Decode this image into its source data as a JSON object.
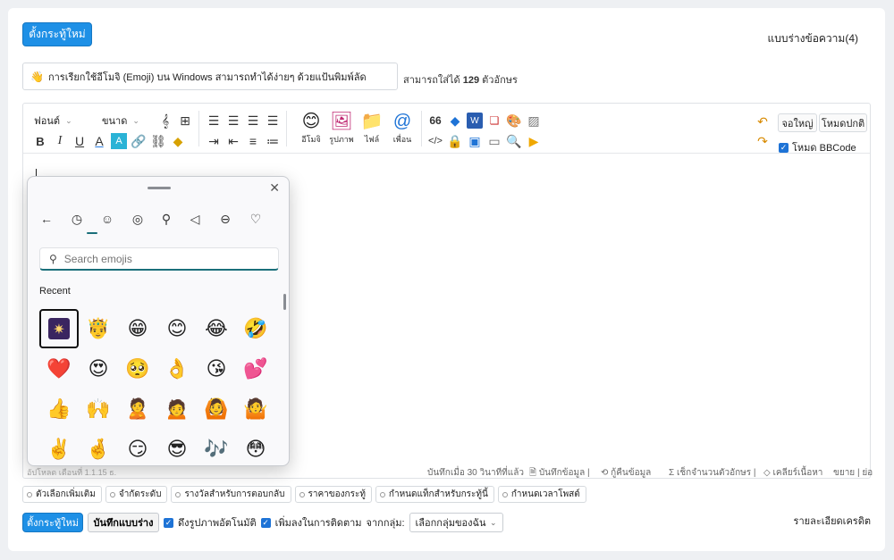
{
  "header": {
    "new_topic_label": "ตั้งกระทู้ใหม่",
    "drafts_label": "แบบร่างข้อความ(4)"
  },
  "title_field": {
    "value": "การเรียกใช้อีโมจิ (Emoji) บน Windows สามารถทำได้ง่ายๆ ด้วยแป้นพิมพ์ลัด",
    "limit_prefix": "สามารถใส่ได้",
    "limit_count": "129",
    "limit_suffix": "ตัวอักษร"
  },
  "toolbar": {
    "font_label": "ฟอนต์",
    "size_label": "ขนาด",
    "emoji_label": "อีโมจิ",
    "image_label": "รูปภาพ",
    "file_label": "ไฟล์",
    "friend_label": "เพื่อน",
    "fullscreen_label": "จอใหญ่",
    "normal_mode_label": "โหมดปกติ",
    "bbcode_label": "โหมด BBCode"
  },
  "status_bar": {
    "cut_text": "อัปโหลด เดือนที่ 1.1.15 ธ.",
    "saved_ago": "บันทึกเมื่อ 30 วินาทีที่แล้ว",
    "save_data": "บันทึกข้อมูล |",
    "restore_data": "กู้คืนข้อมูล",
    "count_chars": "เช็กจำนวนตัวอักษร |",
    "clear_content": "เคลียร์เนื้อหา",
    "expand_collapse": "ขยาย | ย่อ"
  },
  "emoji_panel": {
    "search_placeholder": "Search emojis",
    "recent_label": "Recent",
    "categories": [
      "back-arrow",
      "clock",
      "smiley",
      "face-sticker",
      "kaomoji",
      "pizza",
      "car",
      "heart"
    ],
    "emojis": [
      "🎆",
      "🤴",
      "😁",
      "😊",
      "😂",
      "🤣",
      "❤️",
      "😍",
      "🥺",
      "👌",
      "😘",
      "💕",
      "👍",
      "🙌",
      "🙎",
      "🙍",
      "🙆",
      "🤷",
      "✌️",
      "🤞",
      "😏",
      "😎",
      "🎶",
      "😳"
    ]
  },
  "options": {
    "chips": [
      "ตัวเลือกเพิ่มเติม",
      "จำกัดระดับ",
      "รางวัลสำหรับการตอบกลับ",
      "ราคาของกระทู้",
      "กำหนดแท็กสำหรับกระทู้นี้",
      "กำหนดเวลาโพสต์"
    ]
  },
  "footer": {
    "new_topic_label": "ตั้งกระทู้ใหม่",
    "save_draft_label": "บันทึกแบบร่าง",
    "auto_image_label": "ดึงรูปภาพอัตโนมัติ",
    "follow_label": "เพิ่มลงในการติดตาม",
    "from_group_label": "จากกลุ่ม:",
    "group_select_value": "เลือกกลุ่มของฉัน",
    "credits_label": "รายละเอียดเครดิต"
  }
}
